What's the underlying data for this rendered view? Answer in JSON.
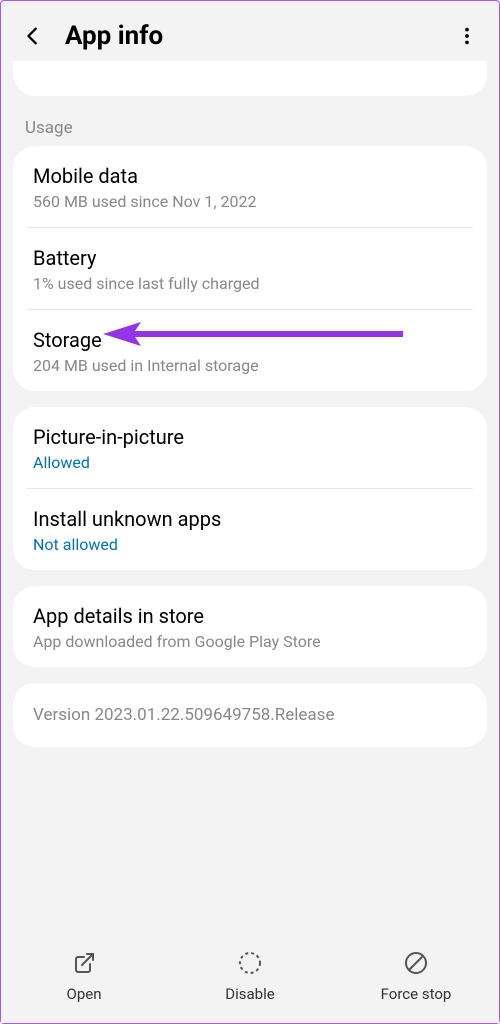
{
  "header": {
    "title": "App info"
  },
  "sections": {
    "usage_label": "Usage",
    "mobile_data": {
      "title": "Mobile data",
      "sub": "560 MB used since Nov 1, 2022"
    },
    "battery": {
      "title": "Battery",
      "sub": "1% used since last fully charged"
    },
    "storage": {
      "title": "Storage",
      "sub": "204 MB used in Internal storage"
    },
    "pip": {
      "title": "Picture-in-picture",
      "sub": "Allowed"
    },
    "install_unknown": {
      "title": "Install unknown apps",
      "sub": "Not allowed"
    },
    "app_details": {
      "title": "App details in store",
      "sub": "App downloaded from Google Play Store"
    },
    "version": "Version 2023.01.22.509649758.Release"
  },
  "bottom": {
    "open": "Open",
    "disable": "Disable",
    "force_stop": "Force stop"
  },
  "colors": {
    "link": "#0072b8",
    "arrow": "#9333ea"
  }
}
